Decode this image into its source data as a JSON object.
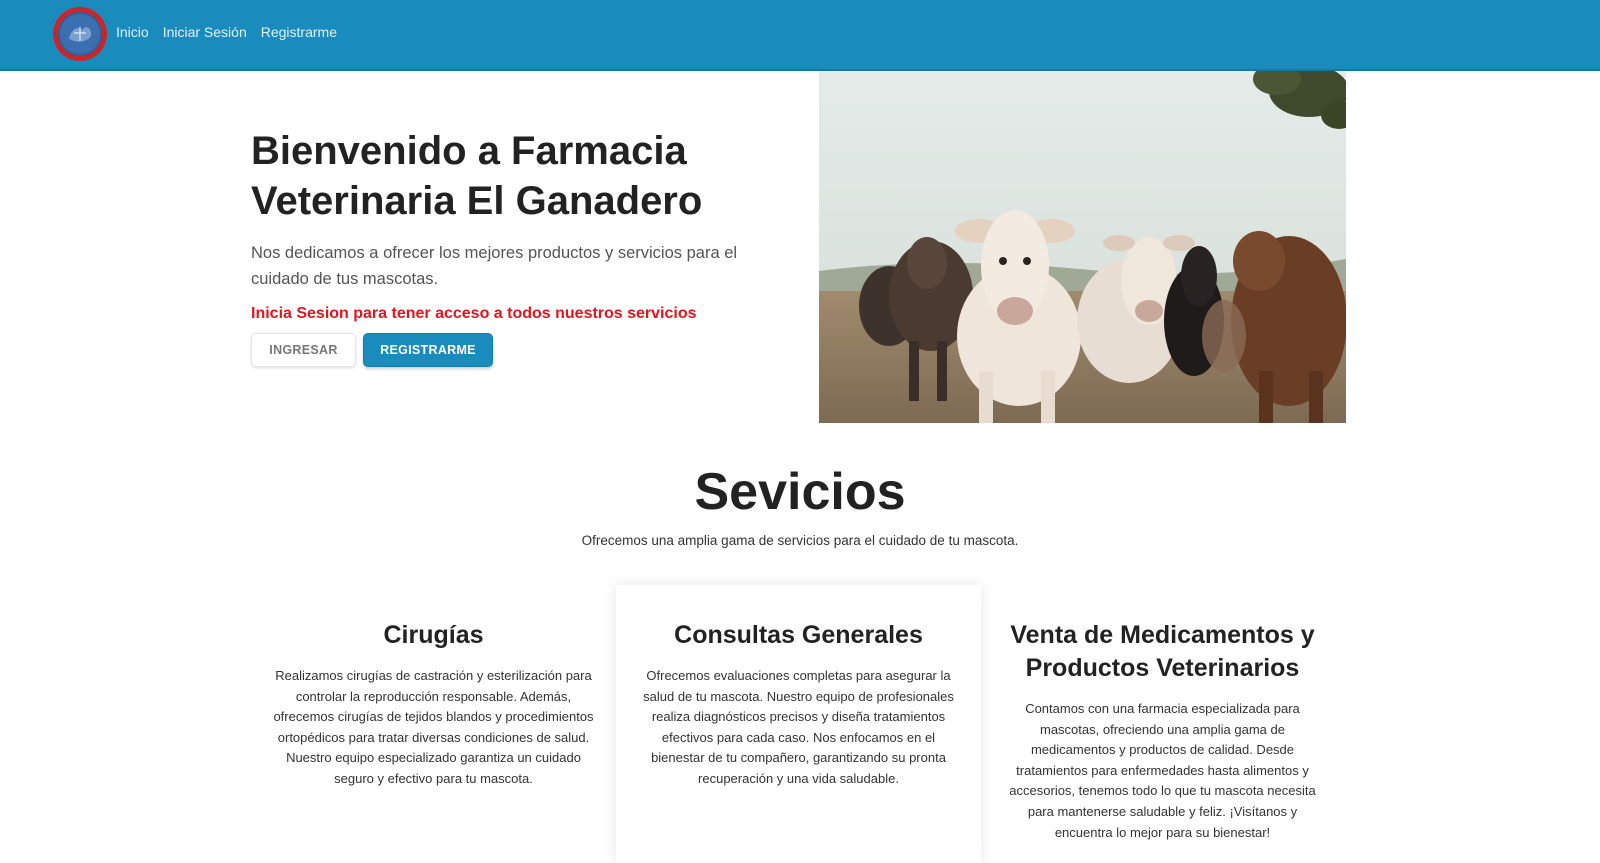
{
  "nav": {
    "logo_alt": "El Ganadero logo",
    "links": [
      "Inicio",
      "Iniciar Sesión",
      "Registrarme"
    ]
  },
  "hero": {
    "title": "Bienvenido a Farmacia Veterinaria El Ganadero",
    "subtitle": "Nos dedicamos a ofrecer los mejores productos y servicios para el cuidado de tus mascotas.",
    "warning": "Inicia Sesion para tener acceso a todos nuestros servicios",
    "btn_ingresar": "INGRESAR",
    "btn_registrarme": "REGISTRARME"
  },
  "services": {
    "title": "Sevicios",
    "subtitle": "Ofrecemos una amplia gama de servicios para el cuidado de tu mascota.",
    "cards": [
      {
        "title": "Cirugías",
        "text": "Realizamos cirugías de castración y esterilización para controlar la reproducción responsable. Además, ofrecemos cirugías de tejidos blandos y procedimientos ortopédicos para tratar diversas condiciones de salud. Nuestro equipo especializado garantiza un cuidado seguro y efectivo para tu mascota."
      },
      {
        "title": "Consultas Generales",
        "text": "Ofrecemos evaluaciones completas para asegurar la salud de tu mascota. Nuestro equipo de profesionales realiza diagnósticos precisos y diseña tratamientos efectivos para cada caso. Nos enfocamos en el bienestar de tu compañero, garantizando su pronta recuperación y una vida saludable."
      },
      {
        "title": "Venta de Medicamentos y Productos Veterinarios",
        "text": "Contamos con una farmacia especializada para mascotas, ofreciendo una amplia gama de medicamentos y productos de calidad. Desde tratamientos para enfermedades hasta alimentos y accesorios, tenemos todo lo que tu mascota necesita para mantenerse saludable y feliz. ¡Visítanos y encuentra lo mejor para su bienestar!"
      }
    ]
  },
  "colors": {
    "brand": "#1a8bbd",
    "warning": "#e0161e"
  }
}
